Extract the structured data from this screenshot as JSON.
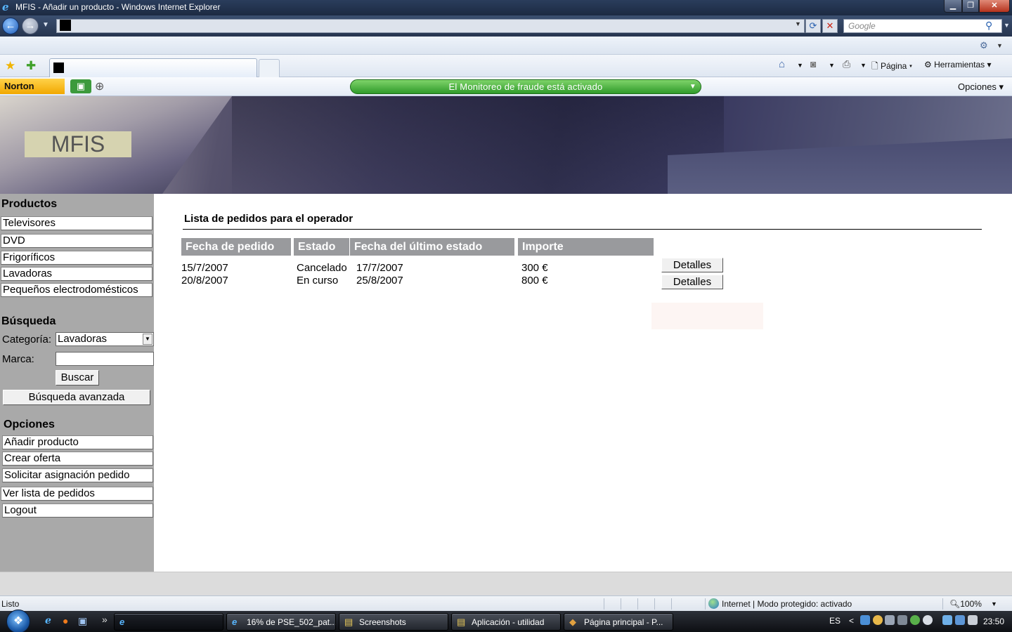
{
  "window": {
    "title": "MFIS -  Añadir un producto - Windows Internet Explorer",
    "minimize_label": "▁",
    "maximize_label": "❐",
    "close_label": "✕"
  },
  "address_bar": {
    "url": "",
    "search_placeholder": "Google"
  },
  "command_bar": {
    "page_label": "Página",
    "tools_label": "Herramientas"
  },
  "norton": {
    "brand": "Norton",
    "fraud_status": "El Monitoreo de fraude está activado",
    "options_label": "Opciones"
  },
  "site": {
    "logo_text": "MFIS"
  },
  "sidebar": {
    "products_heading": "Productos",
    "products": [
      "Televisores",
      "DVD",
      "Frigoríficos",
      "Lavadoras",
      "Pequeños electrodomésticos"
    ],
    "search_heading": "Búsqueda",
    "category_label": "Categoría:",
    "category_value": "Lavadoras",
    "brand_label": "Marca:",
    "brand_value": "",
    "search_button": "Buscar",
    "advanced_search_button": "Búsqueda avanzada",
    "options_heading": "Opciones",
    "options": [
      "Añadir producto",
      "Crear oferta",
      "Solicitar asignación pedido",
      "Ver lista de pedidos",
      "Logout"
    ]
  },
  "main": {
    "heading": "Lista de pedidos para el operador",
    "columns": [
      "Fecha de pedido",
      "Estado",
      "Fecha del último estado",
      "Importe"
    ],
    "rows": [
      {
        "fecha": "15/7/2007",
        "estado": "Cancelado",
        "ultimo": "17/7/2007",
        "importe": "300 €",
        "action": "Detalles"
      },
      {
        "fecha": "20/8/2007",
        "estado": "En curso",
        "ultimo": "25/8/2007",
        "importe": "800 €",
        "action": "Detalles"
      }
    ]
  },
  "status_bar": {
    "status": "Listo",
    "zone": "Internet | Modo protegido: activado",
    "zoom": "100%"
  },
  "taskbar": {
    "tasks": [
      "",
      "16% de PSE_502_pat...",
      "Screenshots",
      "Aplicación - utilidad",
      "Página principal - P..."
    ],
    "language": "ES",
    "clock": "23:50"
  }
}
